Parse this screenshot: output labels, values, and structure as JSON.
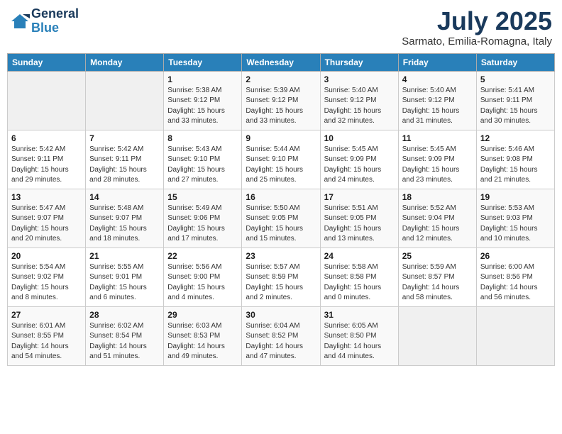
{
  "logo": {
    "line1": "General",
    "line2": "Blue"
  },
  "title": "July 2025",
  "subtitle": "Sarmato, Emilia-Romagna, Italy",
  "days_of_week": [
    "Sunday",
    "Monday",
    "Tuesday",
    "Wednesday",
    "Thursday",
    "Friday",
    "Saturday"
  ],
  "weeks": [
    [
      {
        "num": "",
        "detail": ""
      },
      {
        "num": "",
        "detail": ""
      },
      {
        "num": "1",
        "detail": "Sunrise: 5:38 AM\nSunset: 9:12 PM\nDaylight: 15 hours and 33 minutes."
      },
      {
        "num": "2",
        "detail": "Sunrise: 5:39 AM\nSunset: 9:12 PM\nDaylight: 15 hours and 33 minutes."
      },
      {
        "num": "3",
        "detail": "Sunrise: 5:40 AM\nSunset: 9:12 PM\nDaylight: 15 hours and 32 minutes."
      },
      {
        "num": "4",
        "detail": "Sunrise: 5:40 AM\nSunset: 9:12 PM\nDaylight: 15 hours and 31 minutes."
      },
      {
        "num": "5",
        "detail": "Sunrise: 5:41 AM\nSunset: 9:11 PM\nDaylight: 15 hours and 30 minutes."
      }
    ],
    [
      {
        "num": "6",
        "detail": "Sunrise: 5:42 AM\nSunset: 9:11 PM\nDaylight: 15 hours and 29 minutes."
      },
      {
        "num": "7",
        "detail": "Sunrise: 5:42 AM\nSunset: 9:11 PM\nDaylight: 15 hours and 28 minutes."
      },
      {
        "num": "8",
        "detail": "Sunrise: 5:43 AM\nSunset: 9:10 PM\nDaylight: 15 hours and 27 minutes."
      },
      {
        "num": "9",
        "detail": "Sunrise: 5:44 AM\nSunset: 9:10 PM\nDaylight: 15 hours and 25 minutes."
      },
      {
        "num": "10",
        "detail": "Sunrise: 5:45 AM\nSunset: 9:09 PM\nDaylight: 15 hours and 24 minutes."
      },
      {
        "num": "11",
        "detail": "Sunrise: 5:45 AM\nSunset: 9:09 PM\nDaylight: 15 hours and 23 minutes."
      },
      {
        "num": "12",
        "detail": "Sunrise: 5:46 AM\nSunset: 9:08 PM\nDaylight: 15 hours and 21 minutes."
      }
    ],
    [
      {
        "num": "13",
        "detail": "Sunrise: 5:47 AM\nSunset: 9:07 PM\nDaylight: 15 hours and 20 minutes."
      },
      {
        "num": "14",
        "detail": "Sunrise: 5:48 AM\nSunset: 9:07 PM\nDaylight: 15 hours and 18 minutes."
      },
      {
        "num": "15",
        "detail": "Sunrise: 5:49 AM\nSunset: 9:06 PM\nDaylight: 15 hours and 17 minutes."
      },
      {
        "num": "16",
        "detail": "Sunrise: 5:50 AM\nSunset: 9:05 PM\nDaylight: 15 hours and 15 minutes."
      },
      {
        "num": "17",
        "detail": "Sunrise: 5:51 AM\nSunset: 9:05 PM\nDaylight: 15 hours and 13 minutes."
      },
      {
        "num": "18",
        "detail": "Sunrise: 5:52 AM\nSunset: 9:04 PM\nDaylight: 15 hours and 12 minutes."
      },
      {
        "num": "19",
        "detail": "Sunrise: 5:53 AM\nSunset: 9:03 PM\nDaylight: 15 hours and 10 minutes."
      }
    ],
    [
      {
        "num": "20",
        "detail": "Sunrise: 5:54 AM\nSunset: 9:02 PM\nDaylight: 15 hours and 8 minutes."
      },
      {
        "num": "21",
        "detail": "Sunrise: 5:55 AM\nSunset: 9:01 PM\nDaylight: 15 hours and 6 minutes."
      },
      {
        "num": "22",
        "detail": "Sunrise: 5:56 AM\nSunset: 9:00 PM\nDaylight: 15 hours and 4 minutes."
      },
      {
        "num": "23",
        "detail": "Sunrise: 5:57 AM\nSunset: 8:59 PM\nDaylight: 15 hours and 2 minutes."
      },
      {
        "num": "24",
        "detail": "Sunrise: 5:58 AM\nSunset: 8:58 PM\nDaylight: 15 hours and 0 minutes."
      },
      {
        "num": "25",
        "detail": "Sunrise: 5:59 AM\nSunset: 8:57 PM\nDaylight: 14 hours and 58 minutes."
      },
      {
        "num": "26",
        "detail": "Sunrise: 6:00 AM\nSunset: 8:56 PM\nDaylight: 14 hours and 56 minutes."
      }
    ],
    [
      {
        "num": "27",
        "detail": "Sunrise: 6:01 AM\nSunset: 8:55 PM\nDaylight: 14 hours and 54 minutes."
      },
      {
        "num": "28",
        "detail": "Sunrise: 6:02 AM\nSunset: 8:54 PM\nDaylight: 14 hours and 51 minutes."
      },
      {
        "num": "29",
        "detail": "Sunrise: 6:03 AM\nSunset: 8:53 PM\nDaylight: 14 hours and 49 minutes."
      },
      {
        "num": "30",
        "detail": "Sunrise: 6:04 AM\nSunset: 8:52 PM\nDaylight: 14 hours and 47 minutes."
      },
      {
        "num": "31",
        "detail": "Sunrise: 6:05 AM\nSunset: 8:50 PM\nDaylight: 14 hours and 44 minutes."
      },
      {
        "num": "",
        "detail": ""
      },
      {
        "num": "",
        "detail": ""
      }
    ]
  ]
}
